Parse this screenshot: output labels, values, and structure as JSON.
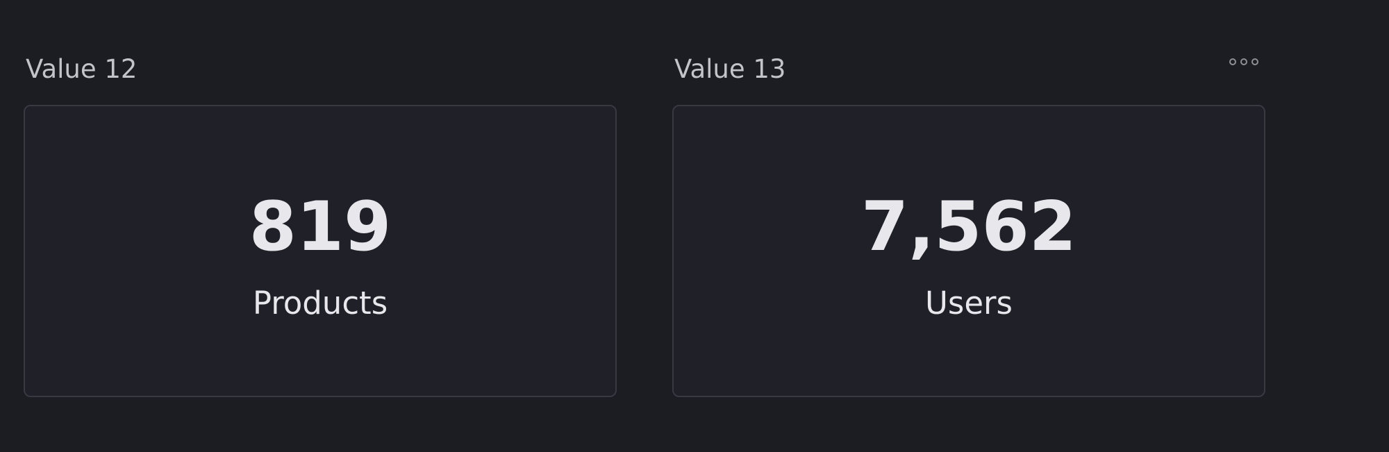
{
  "panels": [
    {
      "title": "Value 12",
      "value": "819",
      "label": "Products"
    },
    {
      "title": "Value 13",
      "value": "7,562",
      "label": "Users",
      "menu_icon": "more-horizontal-icon"
    }
  ],
  "colors": {
    "page_background": "#1c1c23",
    "card_background": "#202029",
    "card_border": "#393944",
    "title_text": "#c3c3ca",
    "value_text": "#e8e8ec",
    "menu_icon": "#8f8f98"
  }
}
